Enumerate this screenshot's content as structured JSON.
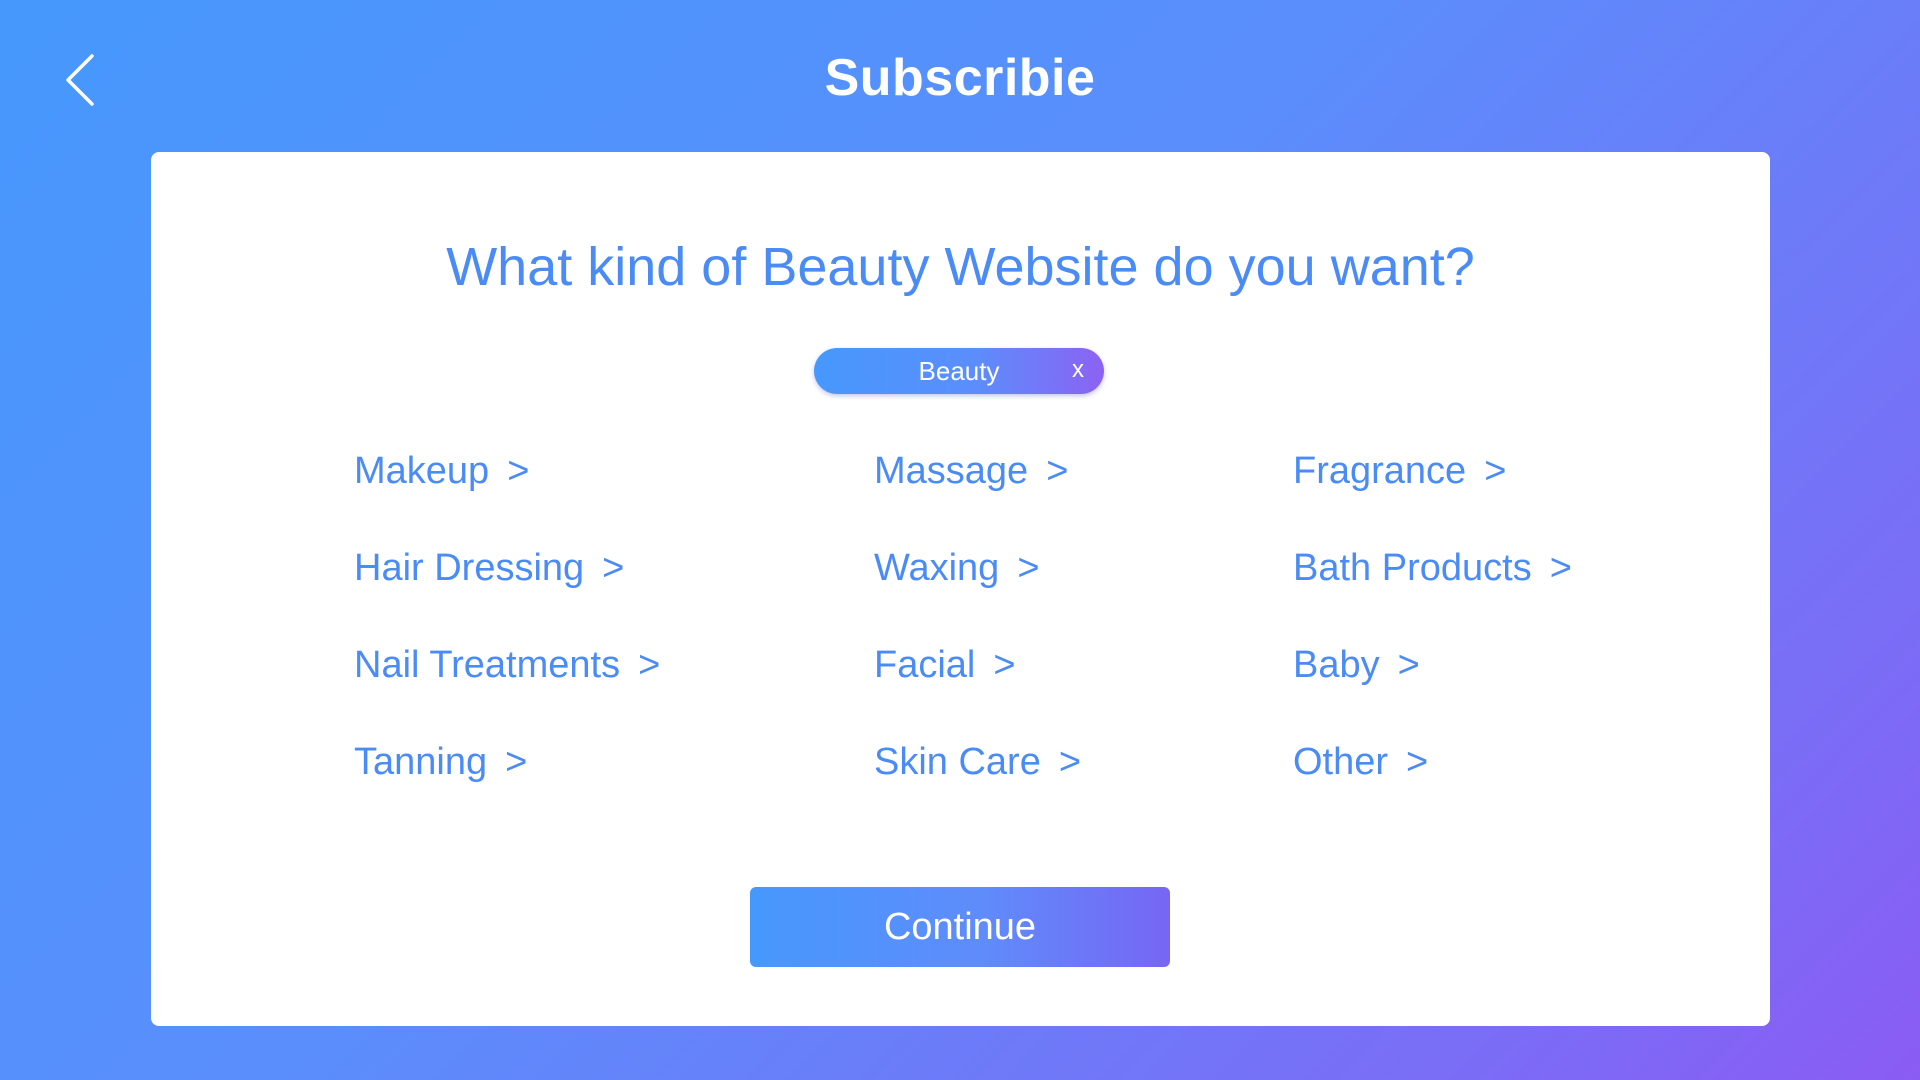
{
  "header": {
    "title": "Subscribie",
    "back_icon": "chevron-left-icon"
  },
  "card": {
    "question": "What kind of Beauty Website do you want?",
    "chip": {
      "label": "Beauty",
      "close_label": "x"
    },
    "categories": [
      {
        "label": "Makeup",
        "arrow": ">"
      },
      {
        "label": "Hair Dressing",
        "arrow": ">"
      },
      {
        "label": "Nail Treatments",
        "arrow": ">"
      },
      {
        "label": "Tanning",
        "arrow": ">"
      },
      {
        "label": "Massage",
        "arrow": ">"
      },
      {
        "label": "Waxing",
        "arrow": ">"
      },
      {
        "label": "Facial",
        "arrow": ">"
      },
      {
        "label": "Skin Care",
        "arrow": ">"
      },
      {
        "label": "Fragrance",
        "arrow": ">"
      },
      {
        "label": "Bath Products",
        "arrow": ">"
      },
      {
        "label": "Baby",
        "arrow": ">"
      },
      {
        "label": "Other",
        "arrow": ">"
      }
    ],
    "continue_label": "Continue"
  },
  "colors": {
    "accent_text": "#4b8bf5",
    "gradient_start": "#4698fd",
    "gradient_end": "#8a5cf4",
    "card_background": "#ffffff"
  }
}
